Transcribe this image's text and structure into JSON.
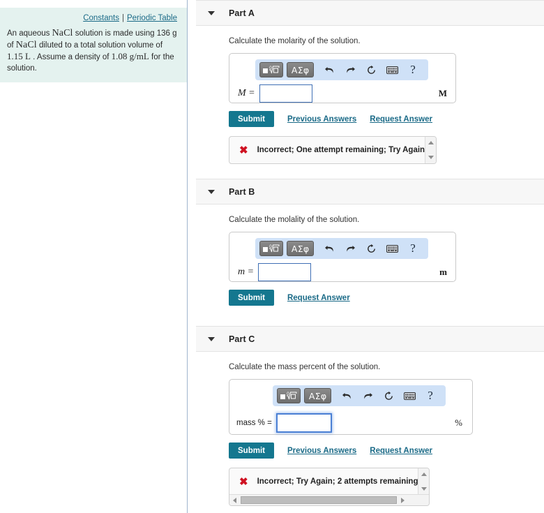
{
  "left_panel": {
    "links": [
      {
        "label": "Constants",
        "name": "constants-link"
      },
      {
        "label": "Periodic Table",
        "name": "periodic-table-link"
      }
    ],
    "separator": "|",
    "problem": {
      "seg1": "An aqueous ",
      "formula1": "NaCl",
      "seg2": " solution is made using 136 g of",
      "formula2": "NaCl",
      "seg3": " diluted to a total solution volume of ",
      "value_volume": "1.15 L",
      "seg4": " .",
      "seg5": "Assume a density of ",
      "value_density": "1.08 g/mL",
      "seg6": " for the solution."
    }
  },
  "mathbar": {
    "template_button_label": "template-icon",
    "greek_button_label": "ΑΣφ",
    "undo_label": "undo-icon",
    "redo_label": "redo-icon",
    "reset_label": "reset-icon",
    "keyboard_label": "keyboard-icon",
    "help_label": "?"
  },
  "colors": {
    "accent": "#14778f",
    "link": "#1a6a87",
    "mathbar_bg": "#cfe1f7",
    "problem_bg": "#e4f2ef",
    "error": "#cf1222",
    "input_border": "#3f6fb5"
  },
  "parts": [
    {
      "id": "part-a",
      "title": "Part A",
      "prompt": "Calculate the molarity of the solution.",
      "var_label": "M =",
      "input_value": "",
      "unit": "M",
      "focused": false,
      "submit_label": "Submit",
      "links": [
        {
          "label": "Previous Answers",
          "name": "previous-answers-link"
        },
        {
          "label": "Request Answer",
          "name": "request-answer-link"
        }
      ],
      "feedback": {
        "icon": "x-mark-icon",
        "text": "Incorrect; One attempt remaining; Try Again",
        "has_vertical_scrollbar": true,
        "has_horizontal_scrollbar": false
      }
    },
    {
      "id": "part-b",
      "title": "Part B",
      "prompt": "Calculate the molality of the solution.",
      "var_label": "m =",
      "input_value": "",
      "unit": "m",
      "focused": false,
      "submit_label": "Submit",
      "links": [
        {
          "label": "Request Answer",
          "name": "request-answer-link"
        }
      ],
      "feedback": null
    },
    {
      "id": "part-c",
      "title": "Part C",
      "prompt": "Calculate the mass percent of the solution.",
      "var_label": "mass % =",
      "input_value": "",
      "unit": "%",
      "focused": true,
      "submit_label": "Submit",
      "links": [
        {
          "label": "Previous Answers",
          "name": "previous-answers-link"
        },
        {
          "label": "Request Answer",
          "name": "request-answer-link"
        }
      ],
      "feedback": {
        "icon": "x-mark-icon",
        "text": "Incorrect; Try Again; 2 attempts remaining",
        "has_vertical_scrollbar": true,
        "has_horizontal_scrollbar": true
      }
    }
  ]
}
